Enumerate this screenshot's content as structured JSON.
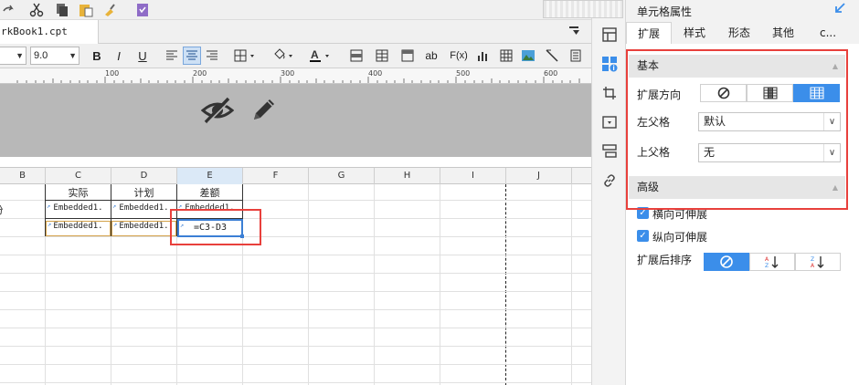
{
  "document": {
    "tab_title": "rkBook1.cpt"
  },
  "format_toolbar": {
    "font_placeholder": "",
    "font_size": "9.0",
    "bold": "B",
    "italic": "I",
    "underline": "U",
    "text_ab": "ab",
    "formula_fx": "F(x)"
  },
  "ruler": {
    "ticks": [
      "100",
      "200",
      "300",
      "400",
      "500",
      "600"
    ]
  },
  "sheet": {
    "columns": [
      "B",
      "C",
      "D",
      "E",
      "F",
      "G",
      "H",
      "I",
      "J"
    ],
    "selected_column": "E",
    "header_row": {
      "c": "实际",
      "d": "计划",
      "e": "差额",
      "b": "份"
    },
    "row2": {
      "c": "Embedded1.",
      "d": "Embedded1.",
      "e": "Embedded1."
    },
    "row3": {
      "c": "Embedded1.",
      "d": "Embedded1.",
      "e": "=C3-D3"
    }
  },
  "panel": {
    "title": "单元格属性",
    "tabs": [
      "扩展",
      "样式",
      "形态",
      "其他",
      "c..."
    ],
    "active_tab": "扩展",
    "basic_section": "基本",
    "expand_direction_label": "扩展方向",
    "left_parent_label": "左父格",
    "left_parent_value": "默认",
    "top_parent_label": "上父格",
    "top_parent_value": "无",
    "advanced_section": "高级",
    "horizontal_extensible": "横向可伸展",
    "vertical_extensible": "纵向可伸展",
    "sort_after_expand_label": "扩展后排序",
    "accent_color": "#3b8eea",
    "highlight_color": "#e8403c"
  }
}
